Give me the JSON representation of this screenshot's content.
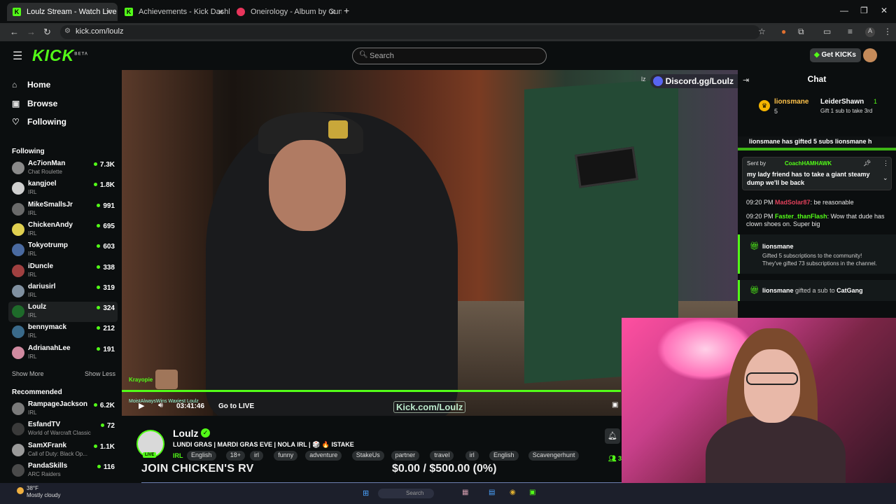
{
  "browser": {
    "tabs": [
      {
        "label": "Loulz Stream - Watch Live on K",
        "active": true,
        "favicon_color": "#53fc18",
        "favicon_text": "K"
      },
      {
        "label": "Achievements - Kick Dashboard",
        "active": false,
        "favicon_color": "#53fc18",
        "favicon_text": "K"
      },
      {
        "label": "Oneirology - Album by Cunnin",
        "active": false,
        "favicon_color": "#e8355b",
        "favicon_text": ""
      }
    ],
    "url": "kick.com/loulz"
  },
  "header": {
    "logo": "KICK",
    "logo_sup": "BETA",
    "search_placeholder": "Search",
    "get_kicks": "Get KICKs"
  },
  "sidebar": {
    "nav": [
      {
        "label": "Home",
        "icon": "home-icon",
        "glyph": "⌂"
      },
      {
        "label": "Browse",
        "icon": "browse-icon",
        "glyph": "▣"
      },
      {
        "label": "Following",
        "icon": "heart-icon",
        "glyph": "♡"
      }
    ],
    "following_heading": "Following",
    "following": [
      {
        "name": "Ac7ionMan",
        "category": "Chat Roulette",
        "viewers": "7.3K",
        "color": "#8a8a8a"
      },
      {
        "name": "kangjoel",
        "category": "IRL",
        "viewers": "1.8K",
        "color": "#d0d0d0"
      },
      {
        "name": "MikeSmallsJr",
        "category": "IRL",
        "viewers": "991",
        "color": "#6a6a6a"
      },
      {
        "name": "ChickenAndy",
        "category": "IRL",
        "viewers": "695",
        "color": "#e0d050"
      },
      {
        "name": "Tokyotrump",
        "category": "IRL",
        "viewers": "603",
        "color": "#4a6aa0"
      },
      {
        "name": "iDuncle",
        "category": "IRL",
        "viewers": "338",
        "color": "#a04040"
      },
      {
        "name": "dariusirl",
        "category": "IRL",
        "viewers": "319",
        "color": "#8090a0"
      },
      {
        "name": "Loulz",
        "category": "IRL",
        "viewers": "324",
        "color": "#1e6a2a"
      },
      {
        "name": "bennymack",
        "category": "IRL",
        "viewers": "212",
        "color": "#3a6a8a"
      },
      {
        "name": "AdrianahLee",
        "category": "IRL",
        "viewers": "191",
        "color": "#d08aa0"
      }
    ],
    "show_more": "Show More",
    "show_less": "Show Less",
    "recommended_heading": "Recommended",
    "recommended": [
      {
        "name": "RampageJackson",
        "category": "IRL",
        "viewers": "6.2K",
        "color": "#7a7a7a"
      },
      {
        "name": "EsfandTV",
        "category": "World of Warcraft Classic",
        "viewers": "72",
        "color": "#3a3a3a"
      },
      {
        "name": "SamXFrank",
        "category": "Call of Duty: Black Op...",
        "viewers": "1.1K",
        "color": "#9a9a9a"
      },
      {
        "name": "PandaSkills",
        "category": "ARC Raiders",
        "viewers": "116",
        "color": "#4a4a4a"
      }
    ]
  },
  "video": {
    "discord": "Discord.gg/Loulz",
    "corner_mark": "lz",
    "chat_user": "Krayopie",
    "tiny_overlay": "MoistAlwaysWins   Waxiest  Loulz",
    "time": "03:41:46",
    "go_live": "Go to LIVE",
    "watermark": "Kick.com/Loulz",
    "progress": 0.81
  },
  "stream": {
    "name": "Loulz",
    "title": "LUNDI GRAS | MARDI GRAS EVE | NOLA IRL | 🎲 🔥 ISTAKE",
    "category": "IRL",
    "tags": [
      "English",
      "18+",
      "irl",
      "funny",
      "adventure",
      "StakeUs",
      "partner",
      "travel",
      "irl",
      "English",
      "Scavengerhunt"
    ],
    "live_badge": "LIVE",
    "viewers": "3"
  },
  "overlay": {
    "join": "JOIN CHICKEN'S RV",
    "goal": "$0.00 / $500.00 (0%)"
  },
  "chat": {
    "title": "Chat",
    "leader": {
      "user1": "lionsmane",
      "count1": "5",
      "user2": "LeiderShawn",
      "count2": "1",
      "note": "Gift 1 sub to take 3rd"
    },
    "banner": "lionsmane has gifted 5 subs   lionsmane h",
    "pinned": {
      "sent_by": "Sent by",
      "user": "CoachHAMHAWK",
      "text": "my lady friend has to take a giant steamy dump we'll be back"
    },
    "messages": [
      {
        "time": "09:20 PM",
        "user": "MadSolar87",
        "user_color": "#e0405a",
        "text": "be reasonable"
      },
      {
        "time": "09:20 PM",
        "user": "Faster_thanFlash",
        "user_color": "#53fc18",
        "text": "Wow that dude has clown shoes on. Super big"
      }
    ],
    "gift1": {
      "user": "lionsmane",
      "line1": "Gifted 5 subscriptions to the community!",
      "line2": "They've gifted 73 subscriptions in the channel."
    },
    "gift2": {
      "user": "lionsmane",
      "action": "gifted a sub to",
      "target": "CatGang"
    }
  },
  "taskbar": {
    "temp": "38°F",
    "weather": "Mostly cloudy",
    "search": "Search"
  }
}
